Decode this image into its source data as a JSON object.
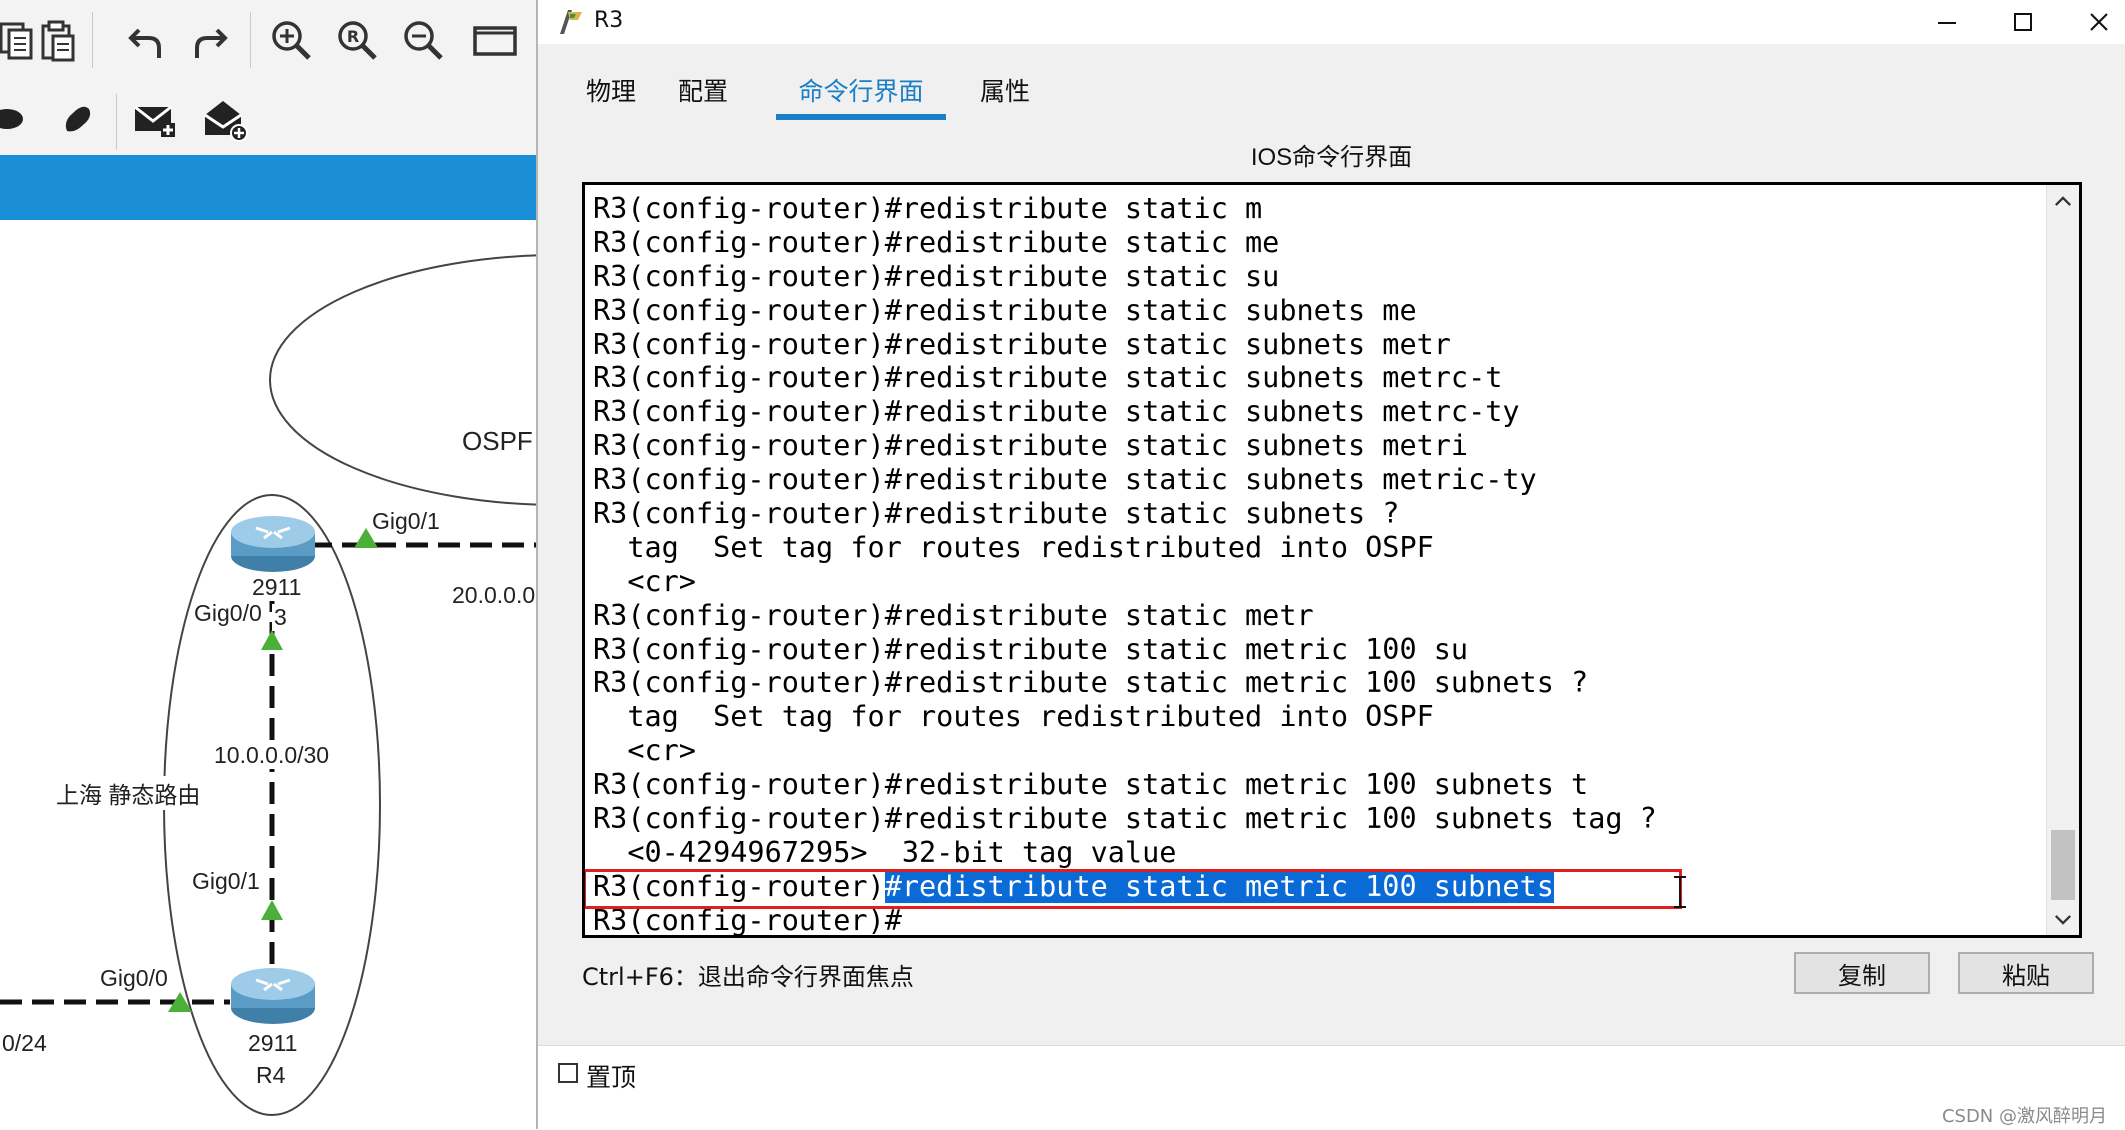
{
  "workspace": {
    "toolbar_icons": [
      "copy-icon",
      "paste-icon",
      "undo-icon",
      "redo-icon",
      "zoom-in-icon",
      "zoom-reset-icon",
      "zoom-out-icon",
      "window-icon"
    ],
    "toolbar2_icons": [
      "ellipse-icon",
      "freeform-icon",
      "add-pdu-icon",
      "complex-pdu-icon"
    ],
    "topology": {
      "ospf_label": "OSPF",
      "net_20": "20.0.0.0",
      "net_10": "10.0.0.0/30",
      "net_left": "0/24",
      "region_label": "上海 静态路由",
      "r3_gig01": "Gig0/1",
      "r3_gig00": "Gig0/0",
      "r3_model": "2911",
      "r3_name": "3",
      "r4_gig01": "Gig0/1",
      "r4_gig00": "Gig0/0",
      "r4_model": "2911",
      "r4_name": "R4"
    }
  },
  "window": {
    "title": "R3",
    "controls": {
      "minimize": "minimize",
      "maximize": "maximize",
      "close": "close"
    }
  },
  "tabs": [
    {
      "label": "物理",
      "active": false
    },
    {
      "label": "配置",
      "active": false
    },
    {
      "label": "命令行界面",
      "active": true
    },
    {
      "label": "属性",
      "active": false
    }
  ],
  "cli": {
    "header": "IOS命令行界面",
    "lines": [
      "R3(config-router)#redistribute static m",
      "R3(config-router)#redistribute static me",
      "R3(config-router)#redistribute static su",
      "R3(config-router)#redistribute static subnets me",
      "R3(config-router)#redistribute static subnets metr",
      "R3(config-router)#redistribute static subnets metrc-t",
      "R3(config-router)#redistribute static subnets metrc-ty",
      "R3(config-router)#redistribute static subnets metri",
      "R3(config-router)#redistribute static subnets metric-ty",
      "R3(config-router)#redistribute static subnets ?",
      "  tag  Set tag for routes redistributed into OSPF",
      "  <cr>",
      "R3(config-router)#redistribute static metr",
      "R3(config-router)#redistribute static metric 100 su",
      "R3(config-router)#redistribute static metric 100 subnets ?",
      "  tag  Set tag for routes redistributed into OSPF",
      "  <cr>",
      "R3(config-router)#redistribute static metric 100 subnets t",
      "R3(config-router)#redistribute static metric 100 subnets tag ?",
      "  <0-4294967295>  32-bit tag value"
    ],
    "highlighted_prefix": "R3(config-router)",
    "highlighted_selection": "#redistribute static metric 100 subnets",
    "prompt_line": "R3(config-router)#"
  },
  "footer": {
    "hint": "Ctrl+F6：退出命令行界面焦点",
    "copy_label": "复制",
    "paste_label": "粘贴",
    "pin_label": "置顶",
    "pin_checked": false,
    "watermark": "CSDN @激风醉明月"
  },
  "colors": {
    "accent": "#1a7fc8",
    "selection": "#0a6ad6",
    "highlight_border": "#e02020",
    "topology_blue": "#1a8fd8"
  }
}
